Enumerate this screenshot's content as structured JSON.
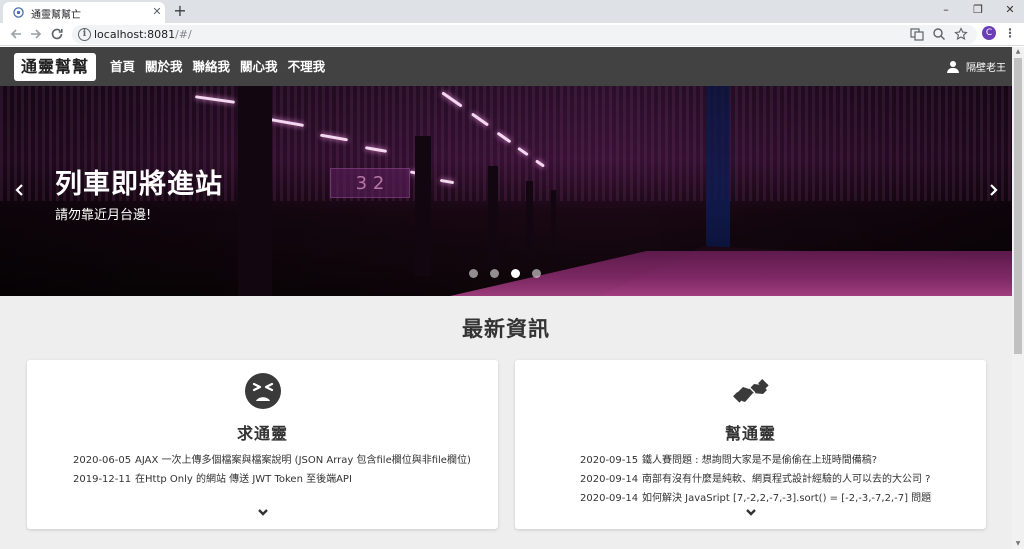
{
  "browser": {
    "tab_title": "通靈幫幫亡",
    "close_label": "✕",
    "new_tab_label": "+",
    "window_controls": [
      "–",
      "❐",
      "✕"
    ],
    "url_host": "localhost:8081",
    "url_path": "/#/",
    "profile_initial": "C",
    "menu_label": "⋮"
  },
  "navbar": {
    "brand": "通靈幫幫亡",
    "links": [
      "首頁",
      "關於我",
      "聯絡我",
      "關心我",
      "不理我"
    ],
    "user_name": "隔壁老王"
  },
  "carousel": {
    "title": "列車即將進站",
    "subtitle": "請勿靠近月台邊!",
    "prev_label": "‹",
    "next_label": "›",
    "sign_text": "3 2",
    "slide_count": 4,
    "active_slide": 3
  },
  "section": {
    "title": "最新資訊"
  },
  "cards": {
    "left": {
      "title": "求通靈",
      "icon": "tired-face-icon",
      "items": [
        {
          "date": "2020-06-05",
          "text": "AJAX 一次上傳多個檔案與檔案說明 (JSON Array 包含file欄位與非file欄位)"
        },
        {
          "date": "2019-12-11",
          "text": "在Http Only 的網站 傳送 JWT Token 至後端API"
        }
      ]
    },
    "right": {
      "title": "幫通靈",
      "icon": "handshake-icon",
      "items": [
        {
          "date": "2020-09-15",
          "text": "鐵人賽問題 : 想詢問大家是不是偷偷在上班時間備稿?"
        },
        {
          "date": "2020-09-14",
          "text": "南部有沒有什麼是純軟、網頁程式設計經驗的人可以去的大公司 ?"
        },
        {
          "date": "2020-09-14",
          "text": "如何解決 JavaSript [7,-2,2,-7,-3].sort() = [-2,-3,-7,2,-7] 問題"
        }
      ]
    }
  },
  "colors": {
    "navbar": "#424242",
    "page_bg": "#eeeeee",
    "profile": "#6a3fb5"
  }
}
